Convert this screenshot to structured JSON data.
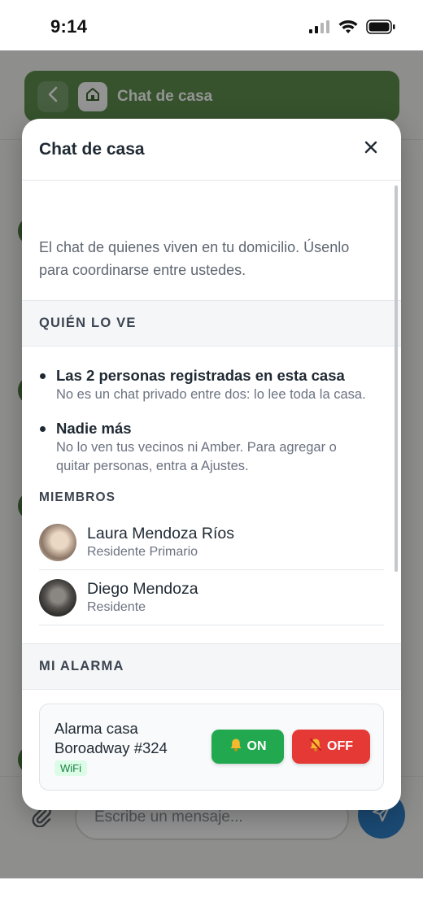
{
  "status_bar": {
    "time": "9:14"
  },
  "app": {
    "header_title": "Chat de casa",
    "composer_placeholder": "Escribe un mensaje..."
  },
  "modal": {
    "title": "Chat de casa",
    "intro": "El chat de quienes viven en tu domicilio. Úsenlo para coordinarse entre ustedes.",
    "who_sees": {
      "heading": "QUIÉN LO VE",
      "items": [
        {
          "title": "Las 2 personas registradas en esta casa",
          "desc": "No es un chat privado entre dos: lo lee toda la casa."
        },
        {
          "title": "Nadie más",
          "desc": "No lo ven tus vecinos ni Amber. Para agregar o quitar personas, entra a Ajustes."
        }
      ]
    },
    "members": {
      "heading": "MIEMBROS",
      "list": [
        {
          "name": "Laura Mendoza Ríos",
          "role": "Residente Primario"
        },
        {
          "name": "Diego Mendoza",
          "role": "Residente"
        }
      ]
    },
    "alarm": {
      "heading": "MI ALARMA",
      "name": "Alarma casa Boroadway #324",
      "badge": "WiFi",
      "on_label": "ON",
      "off_label": "OFF"
    }
  },
  "colors": {
    "header_green": "#5e8f4f",
    "on_green": "#22a94f",
    "off_red": "#e53936",
    "send_blue": "#2f80c9"
  },
  "icons": [
    "signal-icon",
    "wifi-icon",
    "battery-icon",
    "back-icon",
    "home-icon",
    "close-icon",
    "attach-icon",
    "send-icon",
    "bell-icon",
    "bell-off-icon"
  ]
}
